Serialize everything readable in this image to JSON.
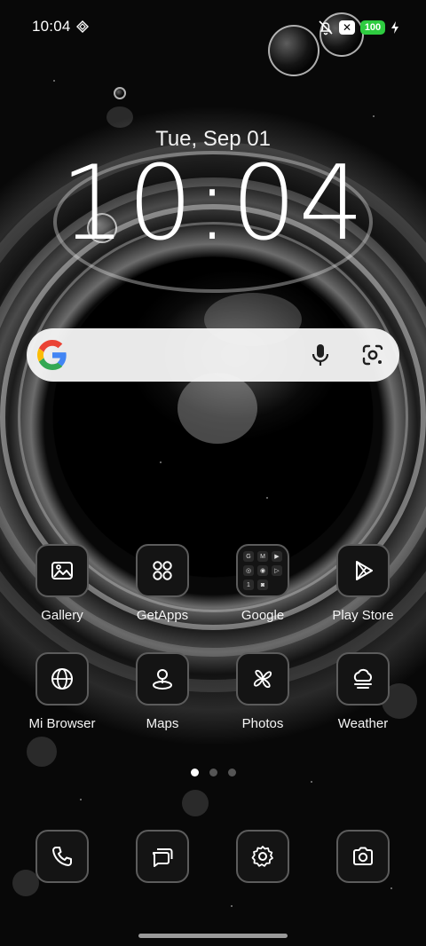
{
  "status_bar": {
    "time": "10:04",
    "battery": "100",
    "icons": [
      "diamond-notification-icon",
      "bell-muted-icon",
      "x-app-icon",
      "battery-icon",
      "charging-bolt-icon"
    ]
  },
  "lock_clock": {
    "date": "Tue, Sep 01",
    "time": "10:04"
  },
  "search": {
    "icons": [
      "google-g-icon",
      "microphone-icon",
      "google-lens-icon"
    ]
  },
  "apps": [
    {
      "label": "Gallery",
      "icon": "gallery-icon"
    },
    {
      "label": "GetApps",
      "icon": "four-dots-icon"
    },
    {
      "label": "Google",
      "icon": "folder-icon"
    },
    {
      "label": "Play Store",
      "icon": "play-triangle-icon"
    },
    {
      "label": "Mi Browser",
      "icon": "globe-icon"
    },
    {
      "label": "Maps",
      "icon": "map-pin-icon"
    },
    {
      "label": "Photos",
      "icon": "pinwheel-icon"
    },
    {
      "label": "Weather",
      "icon": "cloud-sun-icon"
    }
  ],
  "google_folder_items": [
    "G",
    "M",
    "▶",
    "◎",
    "◉",
    "▷",
    "1",
    "◙"
  ],
  "pages": {
    "count": 3,
    "active": 1
  },
  "dock": [
    {
      "icon": "phone-icon"
    },
    {
      "icon": "messages-icon"
    },
    {
      "icon": "settings-gear-icon"
    },
    {
      "icon": "camera-icon"
    }
  ],
  "colors": {
    "battery": "#2ecc40",
    "tile_bg": "#141414",
    "tile_border": "#5c5c5c"
  }
}
